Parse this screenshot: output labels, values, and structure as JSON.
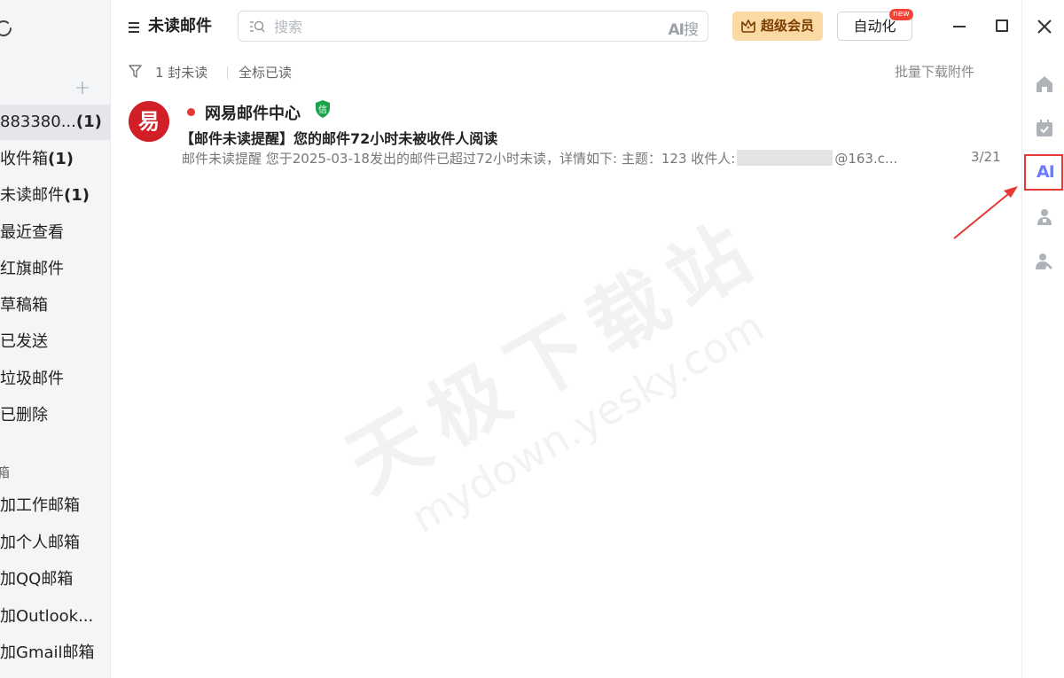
{
  "sidebar": {
    "account": {
      "name": "883380...",
      "count": "(1)"
    },
    "folders": [
      {
        "label": "收件箱",
        "count": "(1)"
      },
      {
        "label": "未读邮件",
        "count": "(1)"
      },
      {
        "label": "最近查看",
        "count": ""
      },
      {
        "label": "红旗邮件",
        "count": ""
      },
      {
        "label": "草稿箱",
        "count": ""
      },
      {
        "label": "已发送",
        "count": ""
      },
      {
        "label": "垃圾邮件",
        "count": ""
      },
      {
        "label": "已删除",
        "count": ""
      }
    ],
    "section_label": "箱",
    "add_items": [
      "加工作邮箱",
      "加个人邮箱",
      "加QQ邮箱",
      "加Outlook...",
      "加Gmail邮箱"
    ]
  },
  "header": {
    "title": "未读邮件",
    "search_placeholder": "搜索",
    "ai_search_prefix": "AI",
    "ai_search_suffix": "搜",
    "vip_label": "超级会员",
    "auto_label": "自动化",
    "new_badge": "new"
  },
  "toolbar": {
    "unread_count": "1 封未读",
    "mark_all_read": "全标已读",
    "batch_download": "批量下载附件"
  },
  "mails": [
    {
      "sender": "网易邮件中心",
      "verified_badge": "信",
      "subject": "【邮件未读提醒】您的邮件72小时未被收件人阅读",
      "preview_start": "邮件未读提醒 您于2025-03-18发出的邮件已超过72小时未读，详情如下:  主题：123 收件人:",
      "preview_end": "@163.c...",
      "date": "3/21"
    }
  ],
  "watermark": {
    "cn": "天极下载站",
    "en": "mydown.yesky.com"
  },
  "rail": {
    "ai_label": "AI",
    "accent_color": "#6c7bff",
    "highlight_color": "#e53935"
  }
}
